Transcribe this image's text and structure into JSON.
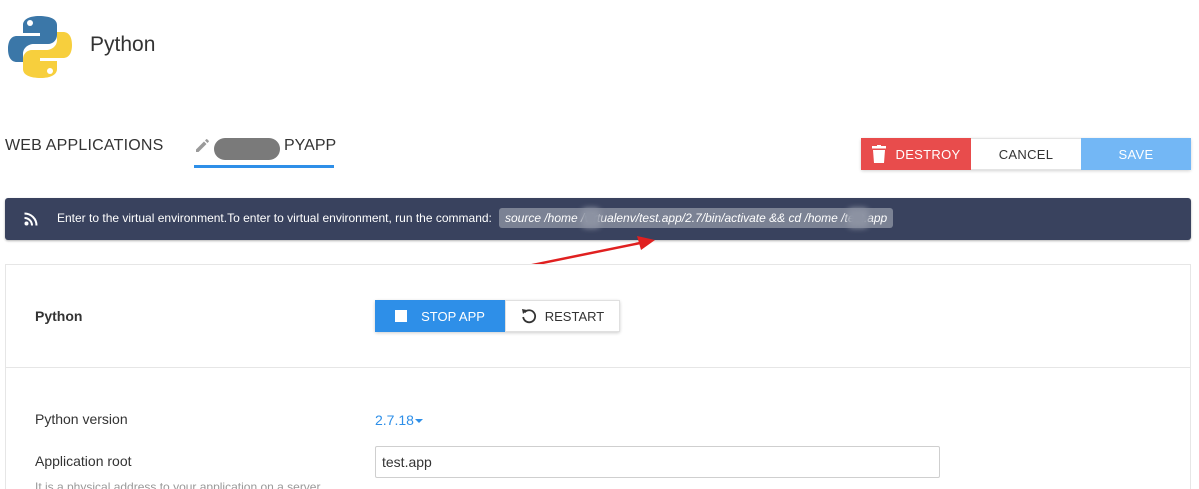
{
  "header": {
    "title": "Python",
    "logo_icon": "python-logo-icon"
  },
  "tabs": {
    "web_applications": "WEB APPLICATIONS",
    "active_suffix": "PYAPP",
    "active_icon": "pencil-icon"
  },
  "actions": {
    "destroy": "DESTROY",
    "cancel": "CANCEL",
    "save": "SAVE",
    "destroy_icon": "trash-icon"
  },
  "banner": {
    "icon": "rss-icon",
    "text": "Enter to the virtual environment.To enter to virtual environment, run the command:",
    "command": "source /home      /virtualenv/test.app/2.7/bin/activate && cd /home       /test.app"
  },
  "section": {
    "label": "Python",
    "stop_label": "STOP APP",
    "restart_label": "RESTART",
    "stop_icon": "stop-square-icon",
    "restart_icon": "restart-icon"
  },
  "form": {
    "python_version_label": "Python version",
    "python_version_value": "2.7.18",
    "app_root_label": "Application root",
    "app_root_value": "test.app",
    "app_root_hint": "It is a physical address to your application on a server"
  },
  "colors": {
    "accent": "#2e8fe8",
    "danger": "#e84c4c",
    "save": "#73b7f5",
    "banner_bg": "#39425e",
    "annotation_arrow": "#e02020"
  }
}
